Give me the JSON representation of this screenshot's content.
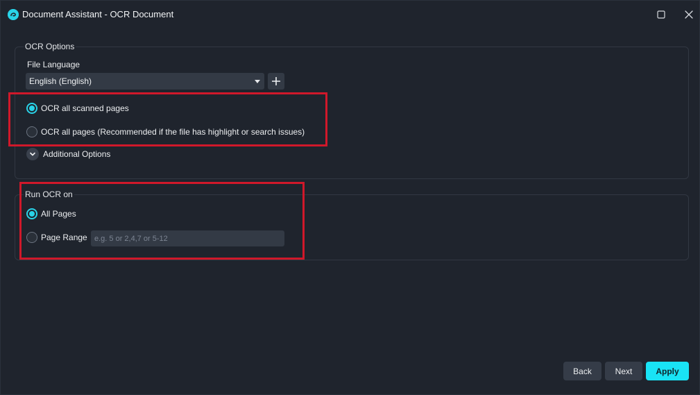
{
  "window": {
    "title": "Document Assistant - OCR Document"
  },
  "ocr_options": {
    "legend": "OCR Options",
    "file_language_label": "File Language",
    "language_selected": "English (English)",
    "radio_options": [
      {
        "label": "OCR all scanned pages",
        "checked": true
      },
      {
        "label": "OCR all pages (Recommended if the file has highlight or search issues)",
        "checked": false
      }
    ],
    "additional_options_label": "Additional Options"
  },
  "run_ocr_on": {
    "legend": "Run OCR on",
    "radio_options": [
      {
        "label": "All Pages",
        "checked": true
      },
      {
        "label": "Page Range",
        "checked": false
      }
    ],
    "page_range_placeholder": "e.g. 5 or 2,4,7 or 5-12",
    "page_range_value": ""
  },
  "footer": {
    "back_label": "Back",
    "next_label": "Next",
    "apply_label": "Apply"
  },
  "icons": {
    "app": "app-logo-icon",
    "maximize": "maximize-icon",
    "close": "close-icon",
    "add": "plus-icon",
    "expand": "chevron-down-icon",
    "dropdown": "caret-down-icon"
  },
  "colors": {
    "accent": "#29d3e8",
    "apply_button": "#19e3f5",
    "background": "#1f242d",
    "highlight_box": "#d0182a"
  }
}
